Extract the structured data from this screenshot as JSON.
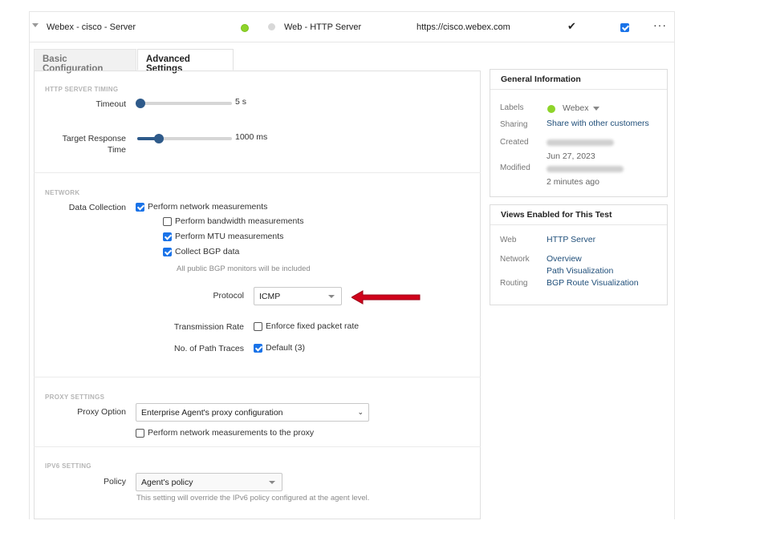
{
  "header": {
    "test_name": "Webex - cisco - Server",
    "type": "Web - HTTP Server",
    "url": "https://cisco.webex.com",
    "status_color": "#8ed42a",
    "check_glyph": "✔",
    "more_glyph": "···"
  },
  "tabs": [
    {
      "label": "Basic Configuration",
      "active": false
    },
    {
      "label": "Advanced Settings",
      "active": true
    }
  ],
  "http_timing": {
    "section": "HTTP SERVER TIMING",
    "timeout": {
      "label": "Timeout",
      "value": "5 s",
      "fraction": 0.0
    },
    "target_response": {
      "label_line1": "Target Response",
      "label_line2": "Time",
      "value": "1000 ms",
      "fraction": 0.2
    }
  },
  "network": {
    "section": "NETWORK",
    "data_collection_label": "Data Collection",
    "perform_network": {
      "label": "Perform network measurements",
      "checked": true
    },
    "bandwidth": {
      "label": "Perform bandwidth measurements",
      "checked": false
    },
    "mtu": {
      "label": "Perform MTU measurements",
      "checked": true
    },
    "bgp": {
      "label": "Collect BGP data",
      "checked": true
    },
    "bgp_hint": "All public BGP monitors will be included",
    "protocol_label": "Protocol",
    "protocol_value": "ICMP",
    "transmission_label": "Transmission Rate",
    "enforce": {
      "label": "Enforce fixed packet rate",
      "checked": false
    },
    "path_traces_label": "No. of Path Traces",
    "path_traces": {
      "label": "Default (3)",
      "checked": true
    }
  },
  "proxy": {
    "section": "PROXY SETTINGS",
    "option_label": "Proxy Option",
    "option_value": "Enterprise Agent's proxy configuration",
    "to_proxy": {
      "label": "Perform network measurements to the proxy",
      "checked": false
    }
  },
  "ipv6": {
    "section": "IPV6 SETTING",
    "policy_label": "Policy",
    "policy_value": "Agent's policy",
    "hint": "This setting will override the IPv6 policy configured at the agent level."
  },
  "general_info": {
    "title": "General Information",
    "labels_key": "Labels",
    "labels_value": "Webex",
    "sharing_key": "Sharing",
    "sharing_value": "Share with other customers",
    "created_key": "Created",
    "created_date": "Jun 27, 2023",
    "modified_key": "Modified",
    "modified_date": "2 minutes ago"
  },
  "views": {
    "title": "Views Enabled for This Test",
    "web_key": "Web",
    "web_value": "HTTP Server",
    "network_key": "Network",
    "network_value1": "Overview",
    "network_value2": "Path Visualization",
    "routing_key": "Routing",
    "routing_value": "BGP Route Visualization"
  },
  "colors": {
    "accent": "#1a73e8",
    "slider": "#2e5a8a",
    "link": "#1f4e79",
    "arrow": "#d0021b"
  }
}
